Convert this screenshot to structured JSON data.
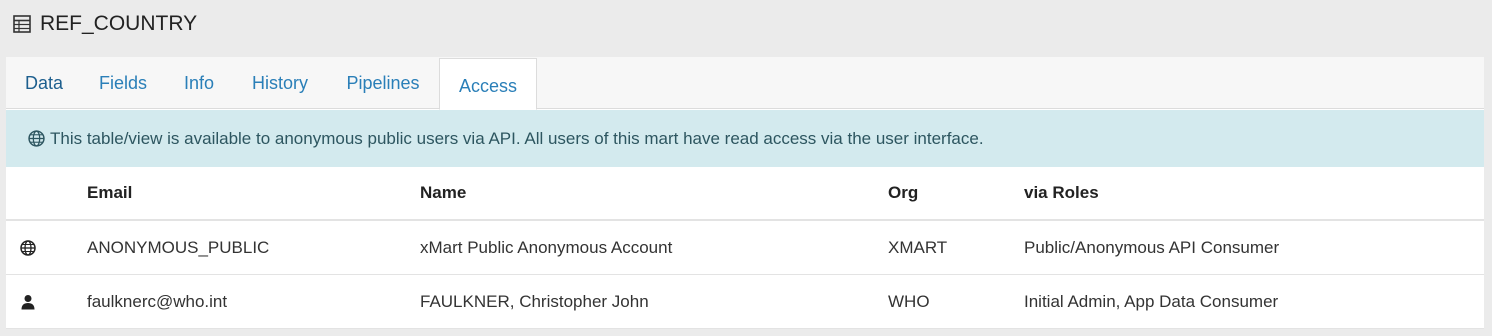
{
  "page": {
    "title": "REF_COUNTRY",
    "title_icon": "table-icon"
  },
  "tabs": [
    {
      "label": "Data",
      "active": false
    },
    {
      "label": "Fields",
      "active": false
    },
    {
      "label": "Info",
      "active": false
    },
    {
      "label": "History",
      "active": false
    },
    {
      "label": "Pipelines",
      "active": false
    },
    {
      "label": "Access",
      "active": true
    }
  ],
  "notice": {
    "icon": "globe-icon",
    "text": "This table/view is available to anonymous public users via API. All users of this mart have read access via the user interface."
  },
  "table": {
    "columns": [
      "Email",
      "Name",
      "Org",
      "via Roles"
    ],
    "rows": [
      {
        "icon": "globe-icon",
        "email": "ANONYMOUS_PUBLIC",
        "name": "xMart Public Anonymous Account",
        "org": "XMART",
        "roles": "Public/Anonymous API Consumer"
      },
      {
        "icon": "user-icon",
        "email": "faulknerc@who.int",
        "name": "FAULKNER, Christopher John",
        "org": "WHO",
        "roles": "Initial Admin, App Data Consumer"
      }
    ]
  },
  "colors": {
    "page_bg": "#ebebeb",
    "tab_link": "#2a7fb8",
    "notice_bg": "#d3eaee",
    "notice_text": "#2d5660"
  }
}
